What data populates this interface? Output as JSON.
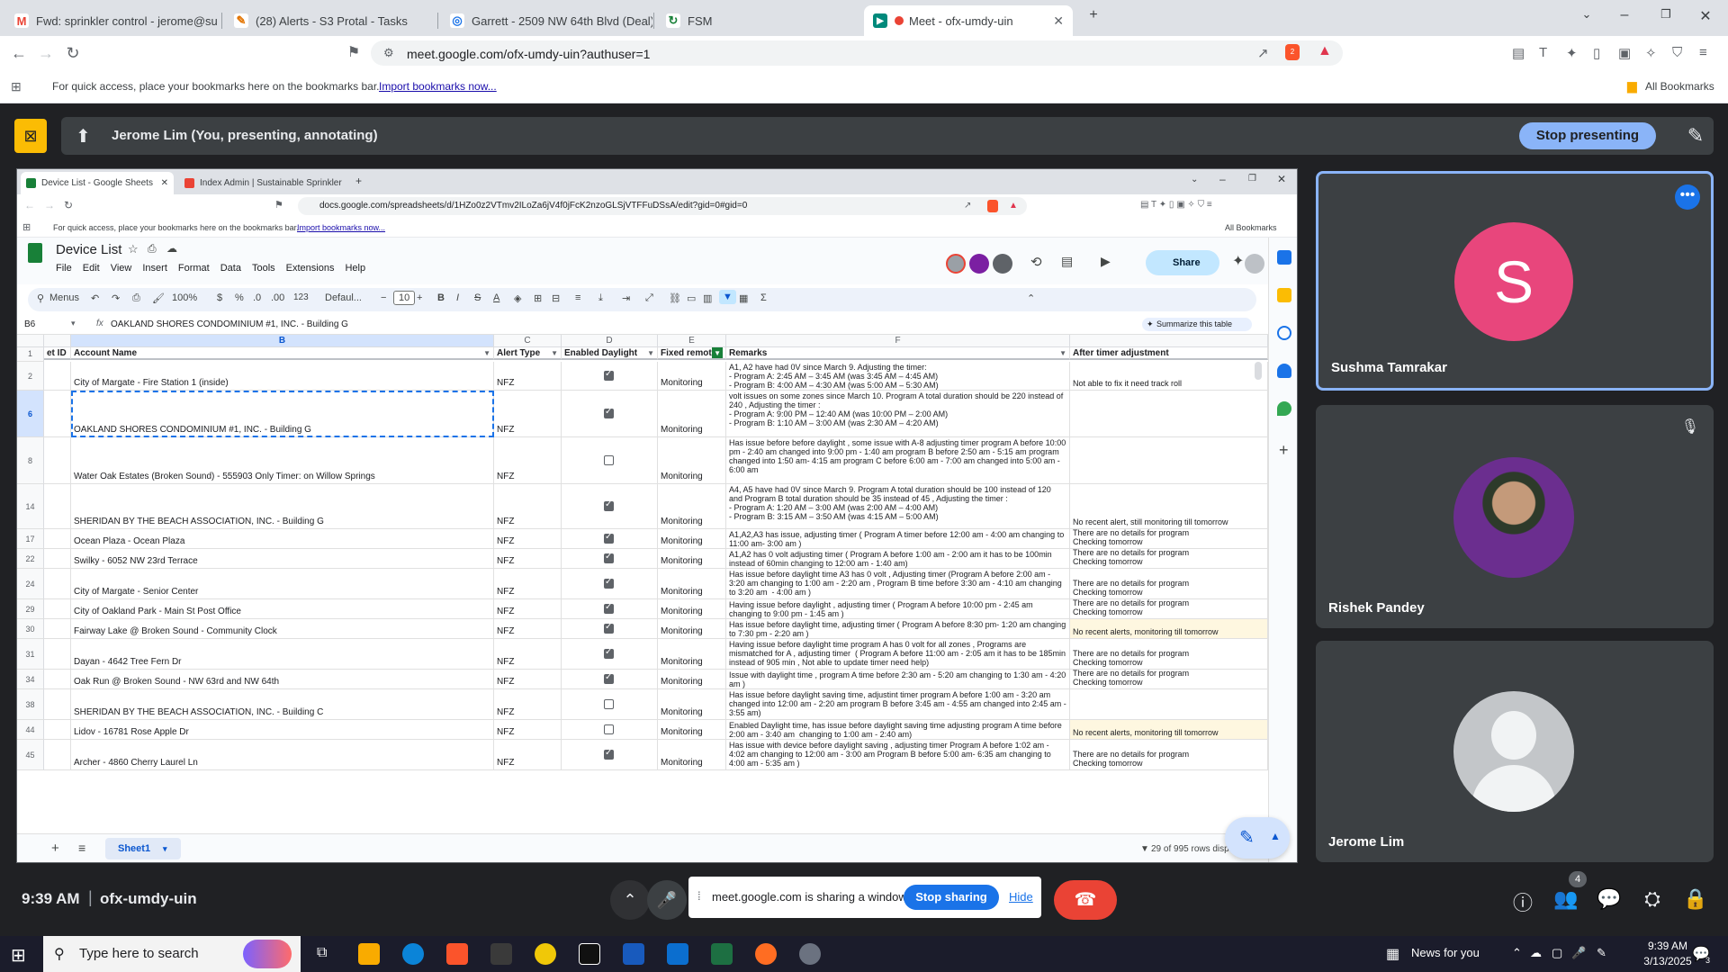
{
  "browser": {
    "tabs": [
      {
        "label": "Fwd: sprinkler control - jerome@su",
        "color": "#ea4335",
        "letter": "M"
      },
      {
        "label": "(28) Alerts - S3 Protal - Tasks",
        "color": "#e37400",
        "letter": "✎"
      },
      {
        "label": "Garrett - 2509 NW 64th Blvd (Deal)",
        "color": "#1a73e8",
        "letter": "◎"
      },
      {
        "label": "FSM",
        "color": "#188038",
        "letter": "↻"
      },
      {
        "label": "Meet - ofx-umdy-uin",
        "color": "#00897b",
        "letter": "▶"
      }
    ],
    "url": "meet.google.com/ofx-umdy-uin?authuser=1",
    "bookmarks_prompt": "For quick access, place your bookmarks here on the bookmarks bar.",
    "import_link": "Import bookmarks now...",
    "all_bookmarks": "All Bookmarks",
    "brave_badge": "2"
  },
  "presenting": {
    "label": "Jerome Lim (You, presenting, annotating)",
    "stop_button": "Stop presenting"
  },
  "shared": {
    "tabs": [
      "Device List - Google Sheets",
      "Index Admin | Sustainable Sprinkler"
    ],
    "url": "docs.google.com/spreadsheets/d/1HZo0z2VTmv2ILoZa6jV4f0jFcK2nzoGLSjVTFFuDSsA/edit?gid=0#gid=0",
    "bookmarks_prompt": "For quick access, place your bookmarks here on the bookmarks bar.",
    "import_link": "Import bookmarks now...",
    "all_bookmarks": "All Bookmarks",
    "doc_title": "Device List",
    "menus": [
      "File",
      "Edit",
      "View",
      "Insert",
      "Format",
      "Data",
      "Tools",
      "Extensions",
      "Help"
    ],
    "share": "Share",
    "toolbar": {
      "menus": "Menus",
      "zoom": "100%",
      "dollar": "$",
      "percent": "%",
      "dec_less": ".0",
      "dec_more": ".00",
      "num": "123",
      "font": "Defaul...",
      "size": "10"
    },
    "name_box": "B6",
    "formula": "OAKLAND SHORES CONDOMINIUM #1, INC. - Building G",
    "summarize": "Summarize this table",
    "col_letters": [
      "B",
      "C",
      "D",
      "E",
      "F"
    ],
    "row_header_num": "1",
    "headers": [
      "et ID",
      "Account Name",
      "Alert Type",
      "Enabled Daylight",
      "Fixed remot",
      "Remarks",
      "After timer adjustment"
    ],
    "rows": [
      {
        "num": "2",
        "account": "City of Margate - Fire Station 1 (inside)",
        "type": "NFZ",
        "checked": true,
        "fixed": "Monitoring",
        "remarks": "A1, A2 have had 0V since March 9. Adjusting the timer:\n- Program A: 2:45 AM – 3:45 AM (was 3:45 AM – 4:45 AM)\n- Program B: 4:00 AM – 4:30 AM (was 5:00 AM – 5:30 AM)",
        "after": "Not able to fix it need track roll",
        "yel": false
      },
      {
        "num": "6",
        "account": "OAKLAND SHORES CONDOMINIUM #1, INC. - Building G",
        "type": "NFZ",
        "checked": true,
        "fixed": "Monitoring",
        "remarks": "volt issues on some zones since March 10. Program A total duration should be 220 instead of 240 , Adjusting the timer :\n- Program A: 9:00 PM – 12:40 AM (was 10:00 PM – 2:00 AM)\n- Program B: 1:10 AM – 3:00 AM (was 2:30 AM – 4:20 AM)",
        "after": "",
        "yel": false
      },
      {
        "num": "8",
        "account": "Water Oak Estates (Broken Sound) - 555903 Only Timer: on Willow Springs",
        "type": "NFZ",
        "checked": false,
        "fixed": "Monitoring",
        "remarks": "Has issue before before daylight , some issue with A-8 adjusting timer program A before 10:00 pm - 2:40 am changed into 9:00 pm - 1:40 am program B before 2:50 am - 5:15 am program changed into 1:50 am- 4:15 am program C before 6:00 am - 7:00 am changed into 5:00 am - 6:00 am",
        "after": "",
        "yel": false
      },
      {
        "num": "14",
        "account": "SHERIDAN BY THE BEACH ASSOCIATION, INC. - Building G",
        "type": "NFZ",
        "checked": true,
        "fixed": "Monitoring",
        "remarks": "A4, A5 have had 0V since March 9. Program A total duration should be 100 instead of 120 and Program B total duration should be 35 instead of 45 , Adjusting the timer :\n- Program A: 1:20 AM – 3:00 AM (was 2:00 AM – 4:00 AM)\n- Program B: 3:15 AM – 3:50 AM (was 4:15 AM – 5:00 AM)",
        "after": "No recent alert, still monitoring till tomorrow",
        "yel": false
      },
      {
        "num": "17",
        "account": "Ocean Plaza - Ocean Plaza",
        "type": "NFZ",
        "checked": true,
        "fixed": "Monitoring",
        "remarks": "A1,A2,A3 has issue, adjusting timer ( Program A timer before 12:00 am - 4:00 am changing to 11:00 am- 3:00 am )",
        "after": "There are no details for program\nChecking tomorrow",
        "yel": false
      },
      {
        "num": "22",
        "account": "Swilky - 6052 NW 23rd Terrace",
        "type": "NFZ",
        "checked": true,
        "fixed": "Monitoring",
        "remarks": "A1,A2 has 0 volt adjusting timer ( Program A before 1:00 am - 2:00 am it has to be 100min instead of 60min changing to 12:00 am - 1:40 am)",
        "after": "There are no details for program\nChecking tomorrow",
        "yel": false
      },
      {
        "num": "24",
        "account": "City of Margate - Senior Center",
        "type": "NFZ",
        "checked": true,
        "fixed": "Monitoring",
        "remarks": "Has issue before daylight time A3 has 0 volt , Adjusting timer (Program A before 2:00 am - 3:20 am changing to 1:00 am - 2:20 am , Program B time before 3:30 am - 4:10 am changing to 3:20 am  - 4:00 am )",
        "after": "There are no details for program\nChecking tomorrow",
        "yel": false
      },
      {
        "num": "29",
        "account": "City of Oakland Park - Main St Post Office",
        "type": "NFZ",
        "checked": true,
        "fixed": "Monitoring",
        "remarks": "Having issue before daylight , adjusting timer ( Program A before 10:00 pm - 2:45 am changing to 9:00 pm - 1:45 am )",
        "after": "There are no details for program\nChecking tomorrow",
        "yel": false
      },
      {
        "num": "30",
        "account": "Fairway Lake @ Broken Sound - Community Clock",
        "type": "NFZ",
        "checked": true,
        "fixed": "Monitoring",
        "remarks": "Has issue before daylight time, adjusting timer ( Program A before 8:30 pm- 1:20 am changing to 7:30 pm - 2:20 am )",
        "after": "No recent alerts, monitoring till tomorrow",
        "yel": true
      },
      {
        "num": "31",
        "account": "Dayan - 4642 Tree Fern Dr",
        "type": "NFZ",
        "checked": true,
        "fixed": "Monitoring",
        "remarks": "Having issue before daylight time program A has 0 volt for all zones , Programs are mismatched for A , adjusting timer  ( Program A before 11:00 am - 2:05 am it has to be 185min instead of 905 min , Not able to update timer need help)",
        "after": "There are no details for program\nChecking tomorrow",
        "yel": false
      },
      {
        "num": "34",
        "account": "Oak Run @ Broken Sound - NW 63rd and NW 64th",
        "type": "NFZ",
        "checked": true,
        "fixed": "Monitoring",
        "remarks": "Issue with daylight time , program A time before 2:30 am - 5:20 am changing to 1:30 am - 4:20 am )",
        "after": "There are no details for program\nChecking tomorrow",
        "yel": false
      },
      {
        "num": "38",
        "account": "SHERIDAN BY THE BEACH ASSOCIATION, INC. - Building C",
        "type": "NFZ",
        "checked": false,
        "fixed": "Monitoring",
        "remarks": "Has issue before daylight saving time, adjustint timer program A before 1:00 am - 3:20 am changed into 12:00 am - 2:20 am program B before 3:45 am - 4:55 am changed into 2:45 am - 3:55 am)",
        "after": "",
        "yel": false
      },
      {
        "num": "44",
        "account": "Lidov - 16781 Rose Apple Dr",
        "type": "NFZ",
        "checked": false,
        "fixed": "Monitoring",
        "remarks": "Enabled Daylight time, has issue before daylight saving time adjusting program A time before 2:00 am - 3:40 am  changing to 1:00 am - 2:40 am)",
        "after": "No recent alerts, monitoring till tomorrow",
        "yel": true
      },
      {
        "num": "45",
        "account": "Archer - 4860 Cherry Laurel Ln",
        "type": "NFZ",
        "checked": true,
        "fixed": "Monitoring",
        "remarks": "Has issue with device before daylight saving , adjusting timer Program A before 1:02 am - 4:02 am changing to 12:00 am - 3:00 am Program B before 5:00 am- 6:35 am changing to 4:00 am - 5:35 am )",
        "after": "There are no details for program\nChecking tomorrow",
        "yel": false
      }
    ],
    "sheet_tab": "Sheet1",
    "rows_displayed": "29 of 995 rows displayed"
  },
  "participants": [
    {
      "name": "Sushma Tamrakar",
      "initial": "S",
      "color": "#e8467c"
    },
    {
      "name": "Rishek Pandey"
    },
    {
      "name": "Jerome Lim"
    }
  ],
  "meeting": {
    "time": "9:39 AM",
    "code": "ofx-umdy-uin",
    "sharing_text": "meet.google.com is sharing a window.",
    "stop_sharing": "Stop sharing",
    "hide": "Hide",
    "people_count": "4"
  },
  "taskbar": {
    "search_placeholder": "Type here to search",
    "news": "News for you",
    "clock_time": "9:39 AM",
    "clock_date": "3/13/2025",
    "notif_count": "3"
  }
}
